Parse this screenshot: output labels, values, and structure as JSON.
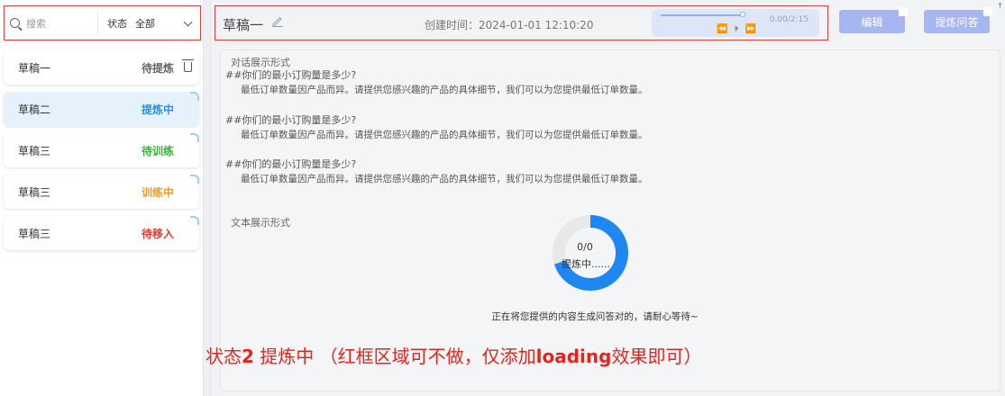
{
  "sidebar": {
    "search_placeholder": "搜索",
    "status_label": "状态",
    "status_value": "全部",
    "items": [
      {
        "name": "草稿一",
        "status": "待提炼",
        "color": "#666666"
      },
      {
        "name": "草稿二",
        "status": "提炼中",
        "color": "#2f8fe0"
      },
      {
        "name": "草稿三",
        "status": "待训练",
        "color": "#3ab03a"
      },
      {
        "name": "草稿三",
        "status": "训练中",
        "color": "#f39a1e"
      },
      {
        "name": "草稿三",
        "status": "待移入",
        "color": "#e03a2f"
      }
    ]
  },
  "header": {
    "title": "草稿一",
    "created": "创建时间：2024-01-01 12:10:20",
    "audio_time": "0.00/2:15",
    "audio_controls": "⏪ ⏵ ⏩",
    "edit_label": "编辑",
    "ask_label": "提炼问答",
    "corner_mark": "↑"
  },
  "main": {
    "dialog_title": "对话展示形式",
    "qa": [
      {
        "q": "##你们的最小订购量是多少?",
        "a": "最低订单数量因产品而异。请提供您感兴趣的产品的具体细节，我们可以为您提供最低订单数量。"
      },
      {
        "q": "##你们的最小订购量是多少?",
        "a": "最低订单数量因产品而异。请提供您感兴趣的产品的具体细节，我们可以为您提供最低订单数量。"
      },
      {
        "q": "##你们的最小订购量是多少?",
        "a": "最低订单数量因产品而异。请提供您感兴趣的产品的具体细节，我们可以为您提供最低订单数量。"
      }
    ],
    "text_title": "文本展示形式",
    "progress": "0/0",
    "processing": "提炼中......",
    "wait_message": "正在将您提供的内容生成问答对的，请耐心等待~",
    "spinner_fraction": 0.7
  },
  "annotation": {
    "part1": "状态",
    "part2": "2",
    "part3": " 提炼中 （红框区域可不做，仅添加",
    "part4": "loading",
    "part5": "效果即可）"
  }
}
